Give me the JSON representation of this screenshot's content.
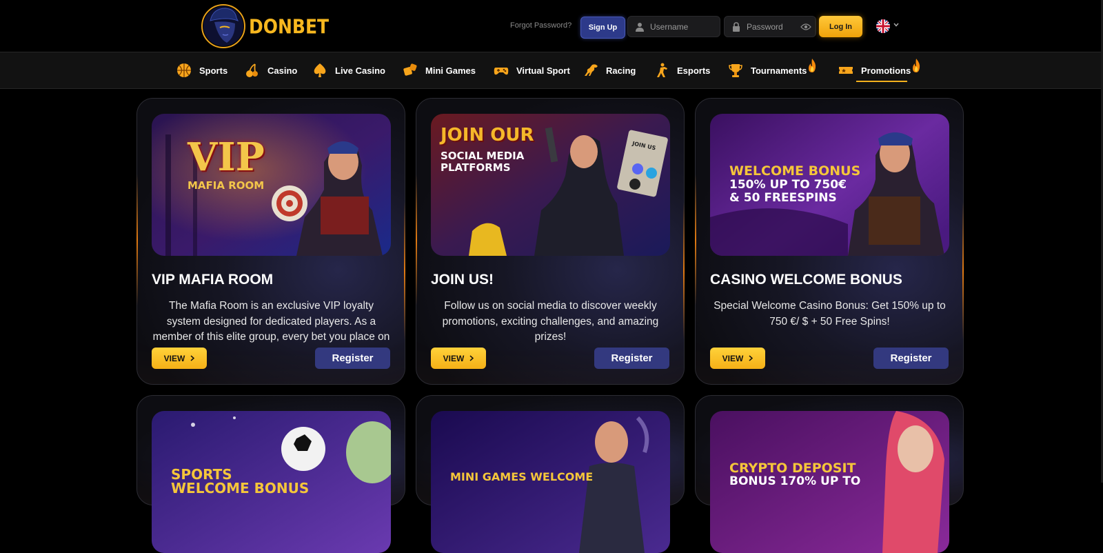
{
  "brand": {
    "name": "DONBET"
  },
  "header": {
    "forgot_password": "Forgot Password?",
    "signup_label": "Sign Up",
    "username_placeholder": "Username",
    "password_placeholder": "Password",
    "login_label": "Log In",
    "language": "English"
  },
  "nav": {
    "items": [
      {
        "label": "Sports",
        "icon": "basketball-icon"
      },
      {
        "label": "Casino",
        "icon": "cherries-icon"
      },
      {
        "label": "Live Casino",
        "icon": "spade-icon"
      },
      {
        "label": "Mini Games",
        "icon": "dice-icon"
      },
      {
        "label": "Virtual Sport",
        "icon": "gamepad-icon"
      },
      {
        "label": "Racing",
        "icon": "horse-icon"
      },
      {
        "label": "Esports",
        "icon": "soldier-icon"
      },
      {
        "label": "Tournaments",
        "icon": "trophy-icon",
        "hot": true
      },
      {
        "label": "Promotions",
        "icon": "ticket-icon",
        "hot": true,
        "active": true
      }
    ]
  },
  "promotions": [
    {
      "title": "VIP MAFIA ROOM",
      "description": "The Mafia Room is an exclusive VIP loyalty system designed for dedicated players. As a member of this elite group, every bet you place on Slots, Sports, or",
      "banner_text": [
        "VIP",
        "MAFIA ROOM"
      ],
      "view_label": "VIEW",
      "register_label": "Register"
    },
    {
      "title": "JOIN US!",
      "description": "Follow us on social media to discover weekly promotions, exciting challenges, and amazing prizes!",
      "banner_text": [
        "JOIN OUR",
        "SOCIAL MEDIA",
        "PLATFORMS",
        "JOIN US"
      ],
      "view_label": "VIEW",
      "register_label": "Register"
    },
    {
      "title": "CASINO WELCOME BONUS",
      "description": "Special Welcome Casino Bonus: Get 150% up to 750 €/ $  + 50 Free Spins!",
      "banner_text": [
        "WELCOME BONUS",
        "150% UP TO 750€",
        "& 50 FREESPINS"
      ],
      "view_label": "VIEW",
      "register_label": "Register"
    },
    {
      "banner_text": [
        "SPORTS",
        "WELCOME BONUS"
      ]
    },
    {
      "banner_text": [
        "MINI GAMES WELCOME"
      ]
    },
    {
      "banner_text": [
        "CRYPTO DEPOSIT",
        "BONUS 170% UP TO"
      ]
    }
  ],
  "colors": {
    "accent": "#f5b21d",
    "register_button": "#33397f",
    "signup_button": "#2d3a8a",
    "background": "#000000"
  }
}
